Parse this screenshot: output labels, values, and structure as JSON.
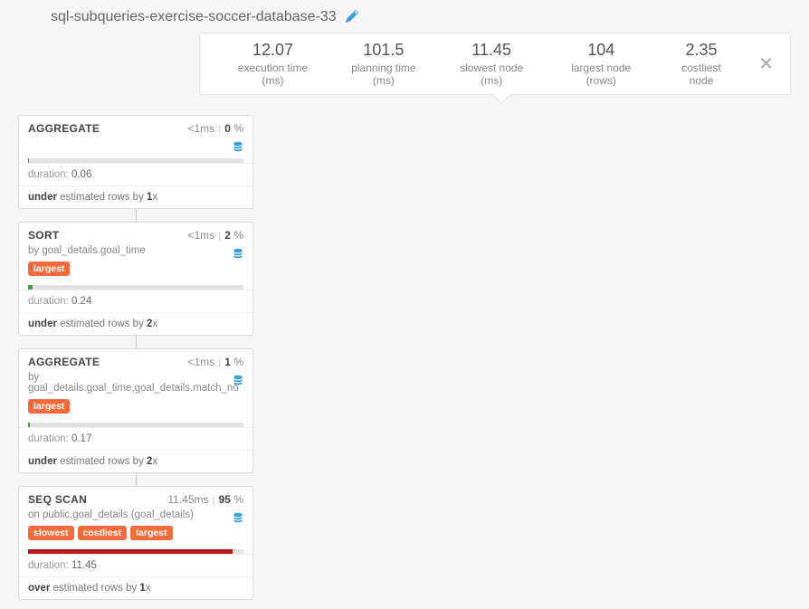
{
  "title": "sql-subqueries-exercise-soccer-database-33",
  "stats": [
    {
      "value": "12.07",
      "label": "execution time (ms)"
    },
    {
      "value": "101.5",
      "label": "planning time (ms)"
    },
    {
      "value": "11.45",
      "label": "slowest node (ms)"
    },
    {
      "value": "104",
      "label": "largest node (rows)"
    },
    {
      "value": "2.35",
      "label": "costliest node"
    }
  ],
  "nodes": [
    {
      "title": "AGGREGATE",
      "time": "<1ms",
      "pct": "0",
      "sub": "",
      "badges": [],
      "bar_pct": 0.5,
      "bar_color": "green",
      "duration": "0.06",
      "est_dir": "under",
      "est_factor": "1"
    },
    {
      "title": "SORT",
      "time": "<1ms",
      "pct": "2",
      "sub": "by goal_details.goal_time",
      "badges": [
        "largest"
      ],
      "bar_pct": 2,
      "bar_color": "green",
      "duration": "0.24",
      "est_dir": "under",
      "est_factor": "2"
    },
    {
      "title": "AGGREGATE",
      "time": "<1ms",
      "pct": "1",
      "sub": "by goal_details.goal_time,goal_details.match_no",
      "badges": [
        "largest"
      ],
      "bar_pct": 1,
      "bar_color": "green",
      "duration": "0.17",
      "est_dir": "under",
      "est_factor": "2"
    },
    {
      "title": "SEQ SCAN",
      "time": "11.45ms",
      "pct": "95",
      "sub": "on public.goal_details (goal_details)",
      "badges": [
        "slowest",
        "costliest",
        "largest"
      ],
      "bar_pct": 95,
      "bar_color": "red",
      "duration": "11.45",
      "est_dir": "over",
      "est_factor": "1"
    }
  ],
  "labels": {
    "duration": "duration:",
    "est_mid": "estimated rows by",
    "x": "x",
    "pct_sign": "%"
  }
}
